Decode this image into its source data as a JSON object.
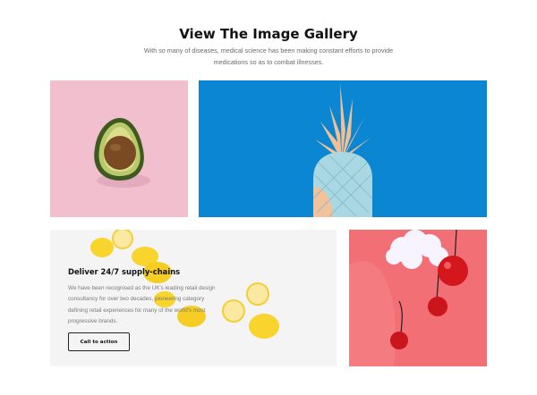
{
  "gallery": {
    "title": "View The Image Gallery",
    "subtitle": "With so many of diseases, medical science has been making constant efforts to provide medications so as to combat illnesses."
  },
  "images": [
    {
      "subject": "avocado-half",
      "background": "#f2bfcf"
    },
    {
      "subject": "pastel-pineapple",
      "background": "#0a86d2"
    },
    {
      "subject": "lemons",
      "background": "#f2f2f2"
    },
    {
      "subject": "cherries-and-cotton-cloud",
      "background": "#f26f76"
    }
  ],
  "promo": {
    "heading": "Deliver 24/7 supply-chains",
    "text": "We have been recognised as the UK's leading retail design consultancy for over two decades, pioneering category defining retail experiences for many of the world's most progressive brands.",
    "cta_label": "Call to action"
  },
  "colors": {
    "heading": "#111111",
    "body_text": "#6b6b6b",
    "cta_border": "#222222"
  }
}
